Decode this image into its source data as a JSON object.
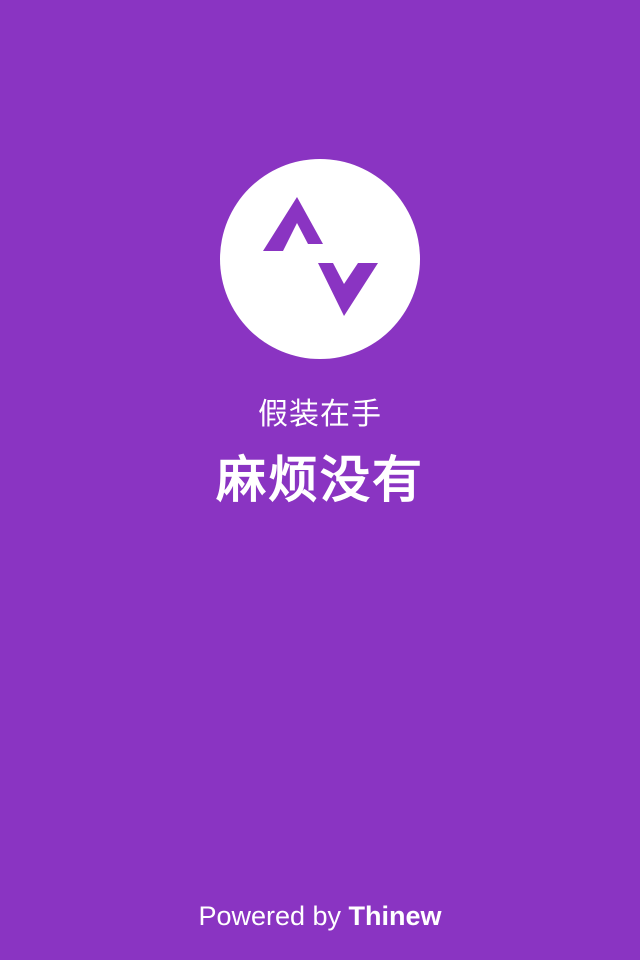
{
  "colors": {
    "background": "#8a34c2",
    "logo_circle": "#ffffff",
    "logo_mark": "#8a34c2",
    "text": "#ffffff"
  },
  "logo": {
    "icon": "strava-style-peaks-icon"
  },
  "tagline": {
    "line1": "假装在手",
    "line2": "麻烦没有"
  },
  "footer": {
    "powered_by": "Powered by",
    "brand": "Thinew"
  }
}
